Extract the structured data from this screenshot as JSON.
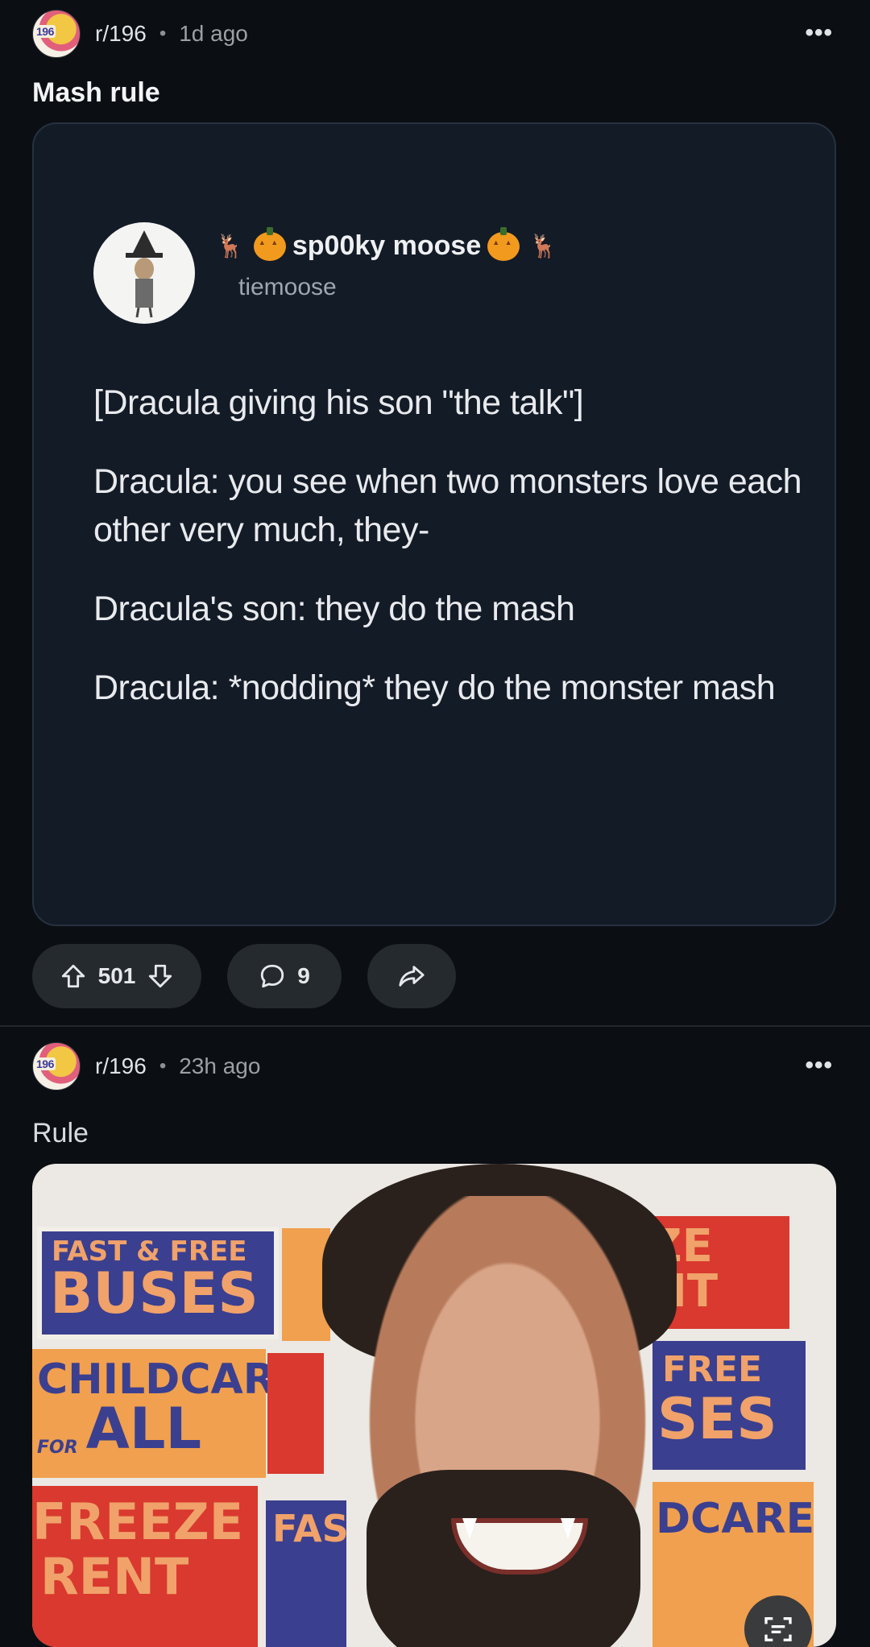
{
  "posts": [
    {
      "subreddit": "r/196",
      "time": "1d ago",
      "title": "Mash rule",
      "tweet": {
        "display_name": "sp00ky moose",
        "handle": "tiemoose",
        "lines": [
          "[Dracula giving his son \"the talk\"]",
          "Dracula: you see when two monsters love each other very much, they-",
          "Dracula's son: they do the mash",
          "Dracula: *nodding* they do the monster mash"
        ]
      },
      "votes": "501",
      "comments": "9"
    },
    {
      "subreddit": "r/196",
      "time": "23h ago",
      "title": "Rule",
      "image_signs": {
        "s1a": "FAST & FREE",
        "s1b": "BUSES",
        "s2a": "CHILDCARE",
        "s2b": "FOR",
        "s2c": "ALL",
        "s3a": "FREEZE",
        "s3b": "RENT",
        "s4": "FAS",
        "s5a": "ZE",
        "s5b": "NT",
        "s6a": "FREE",
        "s6b": "SES",
        "s7": "DCARE"
      }
    }
  ],
  "avatar_tag": "196",
  "icons": {
    "more": "more-options-icon",
    "upvote": "upvote-arrow-icon",
    "downvote": "downvote-arrow-icon",
    "comment": "comment-bubble-icon",
    "share": "share-arrow-icon",
    "scan": "image-scan-icon"
  },
  "colors": {
    "background": "#0b0e12",
    "card": "#131b27",
    "pill": "#252a2f"
  }
}
